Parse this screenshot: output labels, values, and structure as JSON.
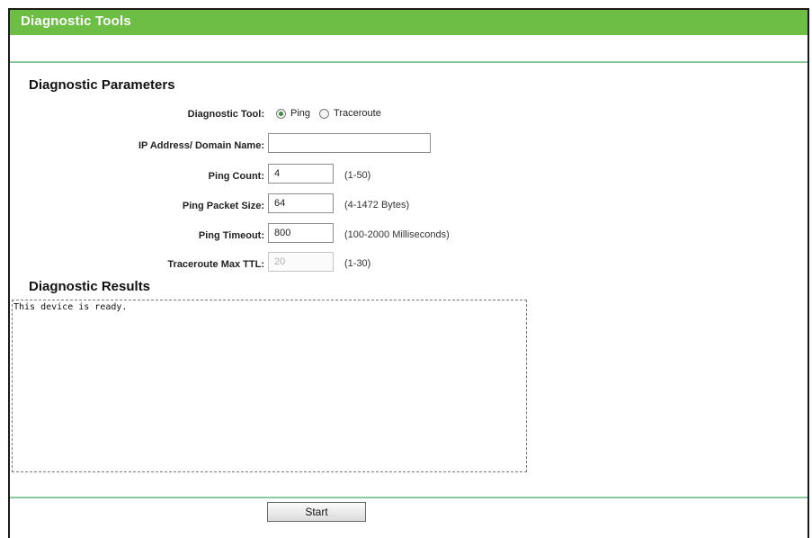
{
  "header": {
    "title": "Diagnostic Tools"
  },
  "parameters": {
    "section_title": "Diagnostic Parameters",
    "tool": {
      "label": "Diagnostic Tool:",
      "options": [
        {
          "label": "Ping",
          "checked": true
        },
        {
          "label": "Traceroute",
          "checked": false
        }
      ]
    },
    "ip_address": {
      "label": "IP Address/ Domain Name:",
      "value": ""
    },
    "ping_count": {
      "label": "Ping Count:",
      "value": "4",
      "hint": "(1-50)"
    },
    "ping_packet_size": {
      "label": "Ping Packet Size:",
      "value": "64",
      "hint": "(4-1472 Bytes)"
    },
    "ping_timeout": {
      "label": "Ping Timeout:",
      "value": "800",
      "hint": "(100-2000 Milliseconds)"
    },
    "traceroute_max_ttl": {
      "label": "Traceroute Max TTL:",
      "value": "20",
      "hint": "(1-30)",
      "disabled": true
    }
  },
  "results": {
    "section_title": "Diagnostic Results",
    "text": "This device is ready."
  },
  "actions": {
    "start_label": "Start"
  },
  "colors": {
    "header_bg": "#6cbe45",
    "divider": "#8cc8a0"
  }
}
